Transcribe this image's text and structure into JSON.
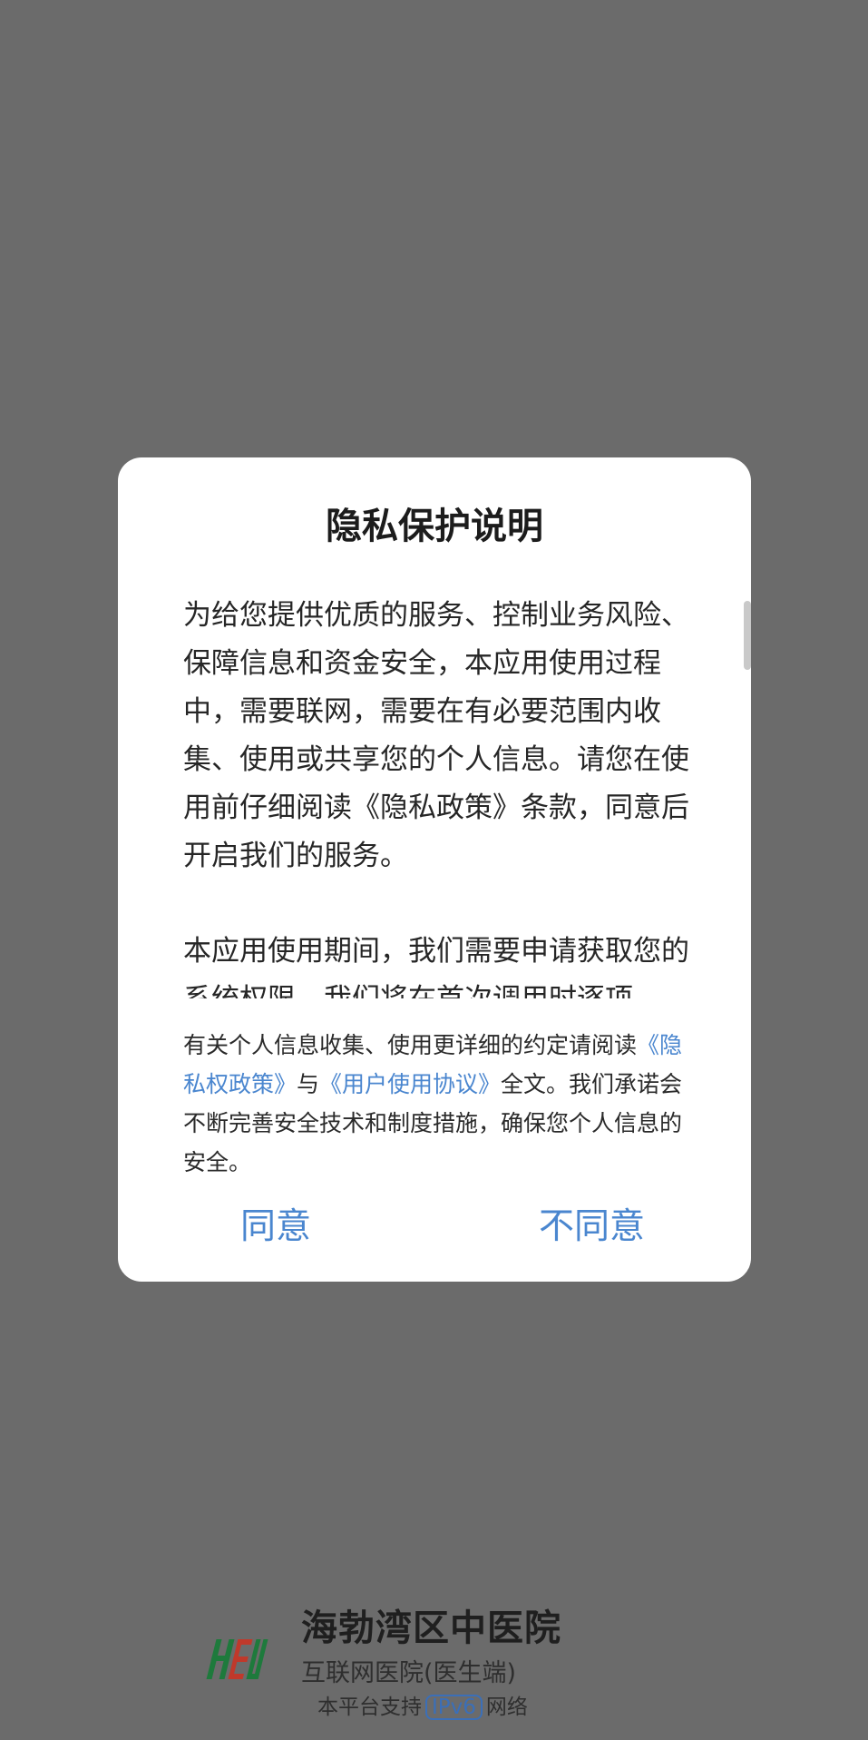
{
  "dialog": {
    "title": "隐私保护说明",
    "paragraph_1": "为给您提供优质的服务、控制业务风险、保障信息和资金安全，本应用使用过程中，需要联网，需要在有必要范围内收集、使用或共享您的个人信息。请您在使用前仔细阅读《隐私政策》条款，同意后开启我们的服务。",
    "paragraph_2": "本应用使用期间，我们需要申请获取您的系统权限，我们将在首次调用时逐项",
    "footer": {
      "prefix": "有关个人信息收集、使用更详细的约定请阅读",
      "privacy_link": "《隐私权政策》",
      "connector": "与",
      "agreement_link": "《用户使用协议》",
      "suffix": "全文。我们承诺会不断完善安全技术和制度措施，确保您个人信息的安全。"
    },
    "agree_label": "同意",
    "disagree_label": "不同意"
  },
  "brand": {
    "name": "海勃湾区中医院",
    "subtitle": "互联网医院(医生端)",
    "ipv6_prefix": "本平台支持",
    "ipv6_tag": "IPv6",
    "ipv6_suffix": "网络",
    "logo_text": "HBW"
  },
  "colors": {
    "overlay": "#6b6b6b",
    "dialog_bg": "#ffffff",
    "link": "#4a86cf",
    "logo_red": "#c0392b",
    "logo_green": "#1e7a3c"
  }
}
